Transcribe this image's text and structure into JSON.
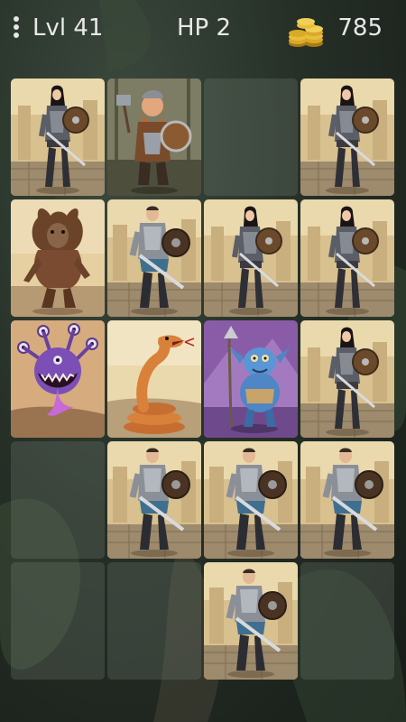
{
  "header": {
    "level_text": "Lvl 41",
    "hp_text": "HP 2",
    "coins_text": "785",
    "menu_icon": "menu-dots-icon",
    "coins_icon": "gold-coins-icon"
  },
  "board": {
    "rows": 5,
    "cols": 4,
    "tiles": [
      "heroine",
      "dwarf",
      "empty",
      "heroine",
      "werewolf",
      "knight",
      "heroine",
      "heroine",
      "beholder",
      "serpent",
      "goblin",
      "heroine",
      "empty",
      "knight",
      "knight",
      "knight",
      "empty",
      "empty",
      "knight",
      "empty"
    ]
  },
  "colors": {
    "card_sky": "#e8d6a8",
    "card_ground": "#b9a07a",
    "goblin_sky": "#8a5ca8",
    "beholder_bg": "#cfa074"
  }
}
